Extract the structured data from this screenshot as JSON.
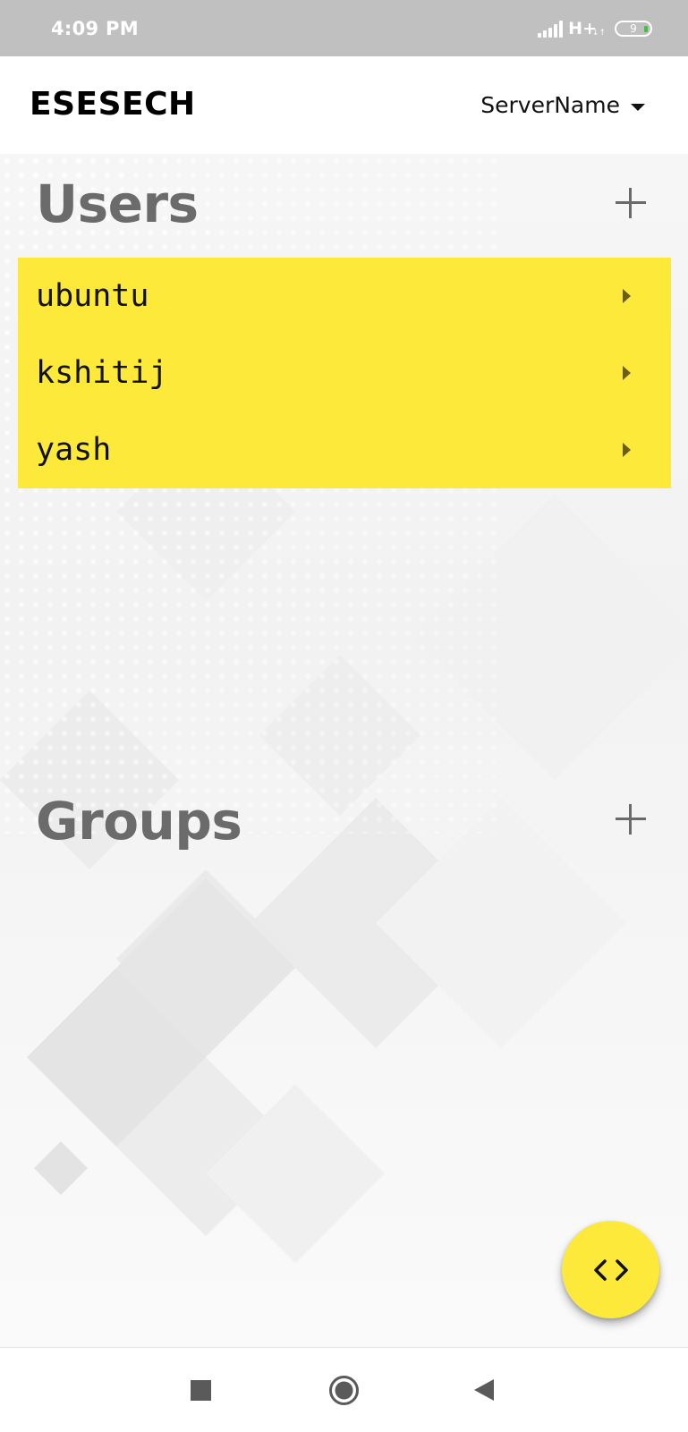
{
  "status_bar": {
    "time": "4:09 PM",
    "network": "H+",
    "network_sub": "↓↑",
    "battery_level": "9",
    "charge_color": "#3cc43c"
  },
  "app_bar": {
    "title": "ESESECH",
    "server_select": "ServerName"
  },
  "users_section": {
    "heading": "Users",
    "items": [
      {
        "label": "ubuntu"
      },
      {
        "label": "kshitij"
      },
      {
        "label": "yash"
      }
    ]
  },
  "groups_section": {
    "heading": "Groups",
    "items": []
  },
  "colors": {
    "accent": "#fde93a",
    "heading": "#6b6b6b",
    "status_bar": "#c0c0c0"
  },
  "icons": {
    "fab": "code-icon",
    "add": "plus-icon",
    "row": "chevron-right-icon",
    "dropdown": "caret-down-icon"
  }
}
